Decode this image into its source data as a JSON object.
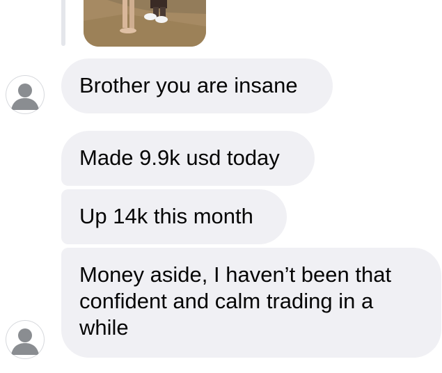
{
  "thread": {
    "shared_photo": {
      "icon": "photo-thumbnail"
    },
    "messages": [
      {
        "text": "Brother you are insane"
      },
      {
        "text": "Made 9.9k usd today"
      },
      {
        "text": "Up 14k this month"
      },
      {
        "text": "Money aside, I haven’t been that confident and calm trading in a while"
      }
    ],
    "avatar_icon": "person-silhouette-icon"
  },
  "colors": {
    "bubble_background": "#f0f0f4",
    "text": "#050505",
    "avatar_silhouette": "#8a8d91",
    "reply_bar": "#e4e6eb"
  }
}
